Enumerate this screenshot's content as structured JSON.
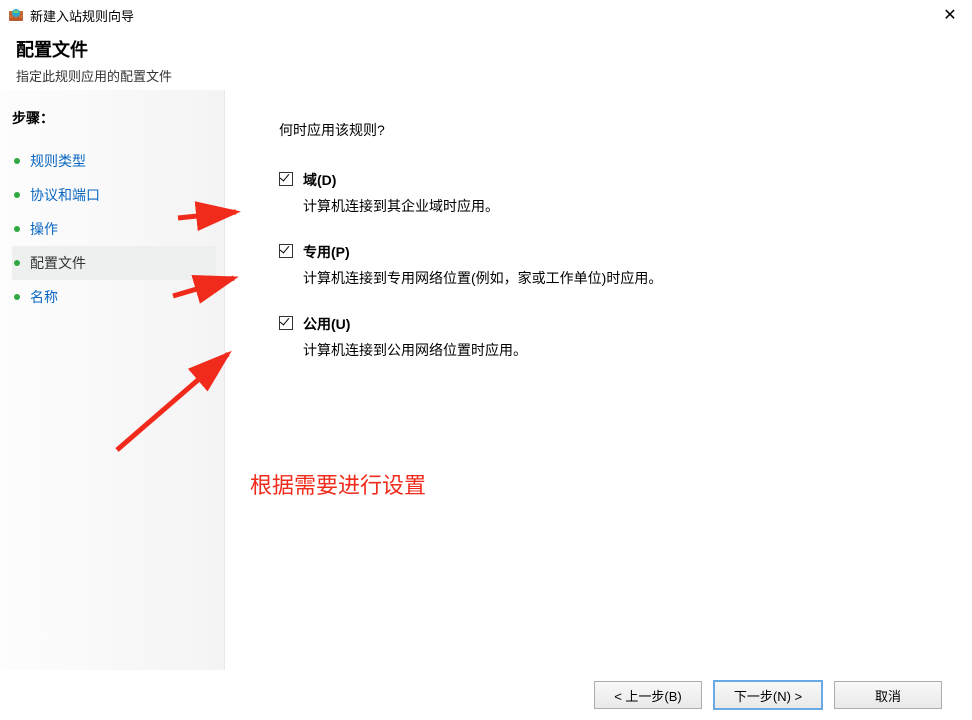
{
  "window": {
    "title": "新建入站规则向导"
  },
  "header": {
    "title": "配置文件",
    "subtitle": "指定此规则应用的配置文件"
  },
  "sidebar": {
    "title": "步骤：",
    "items": [
      {
        "label": "规则类型",
        "active": false
      },
      {
        "label": "协议和端口",
        "active": false
      },
      {
        "label": "操作",
        "active": false
      },
      {
        "label": "配置文件",
        "active": true
      },
      {
        "label": "名称",
        "active": false
      }
    ]
  },
  "main": {
    "question": "何时应用该规则?",
    "options": [
      {
        "key": "domain",
        "label": "域(D)",
        "desc": "计算机连接到其企业域时应用。",
        "checked": true
      },
      {
        "key": "private",
        "label": "专用(P)",
        "desc": "计算机连接到专用网络位置(例如，家或工作单位)时应用。",
        "checked": true
      },
      {
        "key": "public",
        "label": "公用(U)",
        "desc": "计算机连接到公用网络位置时应用。",
        "checked": true
      }
    ]
  },
  "footer": {
    "back": "< 上一步(B)",
    "next": "下一步(N) >",
    "cancel": "取消"
  },
  "annotation": {
    "text": "根据需要进行设置"
  }
}
